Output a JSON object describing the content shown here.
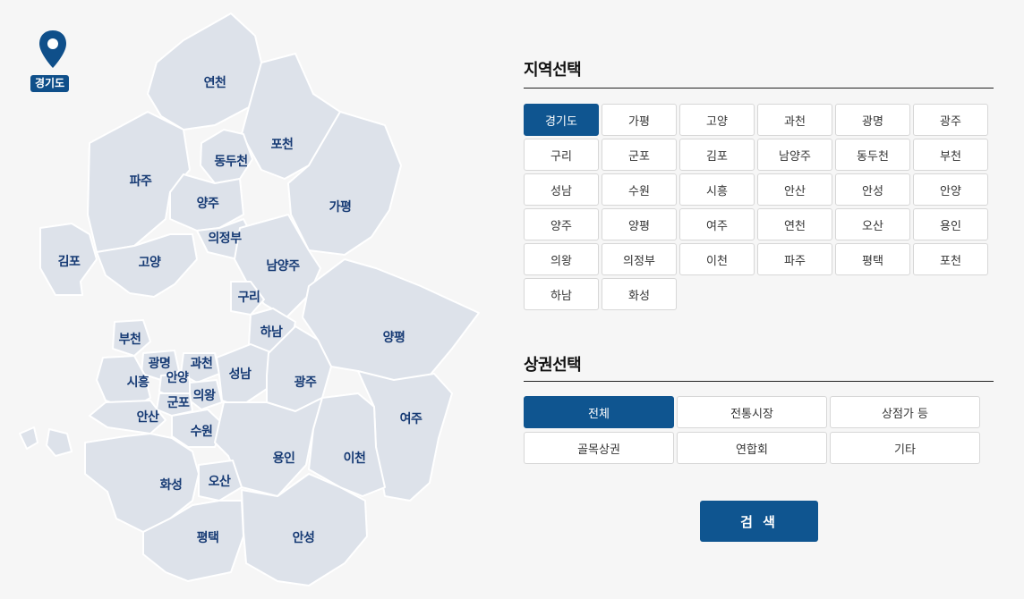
{
  "map": {
    "pin_label": "경기도",
    "pin_icon": "map-pin-icon",
    "colors": {
      "region_fill": "#dde2ea",
      "label": "#163a74",
      "accent": "#0f5590"
    },
    "region_labels": [
      "연천",
      "포천",
      "동두천",
      "파주",
      "양주",
      "가평",
      "의정부",
      "김포",
      "고양",
      "남양주",
      "구리",
      "하남",
      "부천",
      "양평",
      "광명",
      "과천",
      "안양",
      "시흥",
      "의왕",
      "성남",
      "광주",
      "군포",
      "안산",
      "여주",
      "수원",
      "용인",
      "이천",
      "화성",
      "오산",
      "평택",
      "안성"
    ]
  },
  "region_select": {
    "title": "지역선택",
    "selected": "경기도",
    "options": [
      "경기도",
      "가평",
      "고양",
      "과천",
      "광명",
      "광주",
      "구리",
      "군포",
      "김포",
      "남양주",
      "동두천",
      "부천",
      "성남",
      "수원",
      "시흥",
      "안산",
      "안성",
      "안양",
      "양주",
      "양평",
      "여주",
      "연천",
      "오산",
      "용인",
      "의왕",
      "의정부",
      "이천",
      "파주",
      "평택",
      "포천",
      "하남",
      "화성"
    ]
  },
  "market_select": {
    "title": "상권선택",
    "selected": "전체",
    "options": [
      "전체",
      "전통시장",
      "상점가 등",
      "골목상권",
      "연합회",
      "기타"
    ]
  },
  "search_button": "검 색"
}
